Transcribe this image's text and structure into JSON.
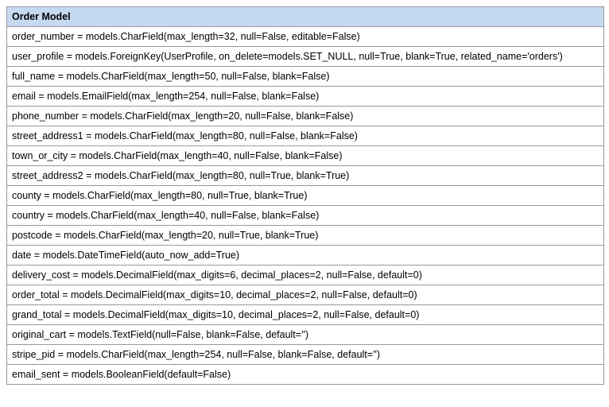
{
  "table": {
    "title": "Order Model",
    "rows": [
      "order_number = models.CharField(max_length=32, null=False, editable=False)",
      "user_profile = models.ForeignKey(UserProfile, on_delete=models.SET_NULL, null=True, blank=True, related_name='orders')",
      "full_name = models.CharField(max_length=50, null=False, blank=False)",
      "email = models.EmailField(max_length=254, null=False, blank=False)",
      "phone_number = models.CharField(max_length=20, null=False, blank=False)",
      "street_address1 = models.CharField(max_length=80, null=False, blank=False)",
      "town_or_city = models.CharField(max_length=40, null=False, blank=False)",
      "street_address2 = models.CharField(max_length=80, null=True, blank=True)",
      "county = models.CharField(max_length=80, null=True, blank=True)",
      "country = models.CharField(max_length=40, null=False, blank=False)",
      "postcode = models.CharField(max_length=20, null=True, blank=True)",
      "date = models.DateTimeField(auto_now_add=True)",
      "delivery_cost = models.DecimalField(max_digits=6, decimal_places=2, null=False, default=0)",
      "order_total = models.DecimalField(max_digits=10, decimal_places=2, null=False, default=0)",
      "grand_total = models.DecimalField(max_digits=10, decimal_places=2, null=False, default=0)",
      "original_cart = models.TextField(null=False, blank=False, default='')",
      "stripe_pid = models.CharField(max_length=254, null=False, blank=False, default='')",
      "email_sent = models.BooleanField(default=False)"
    ]
  }
}
